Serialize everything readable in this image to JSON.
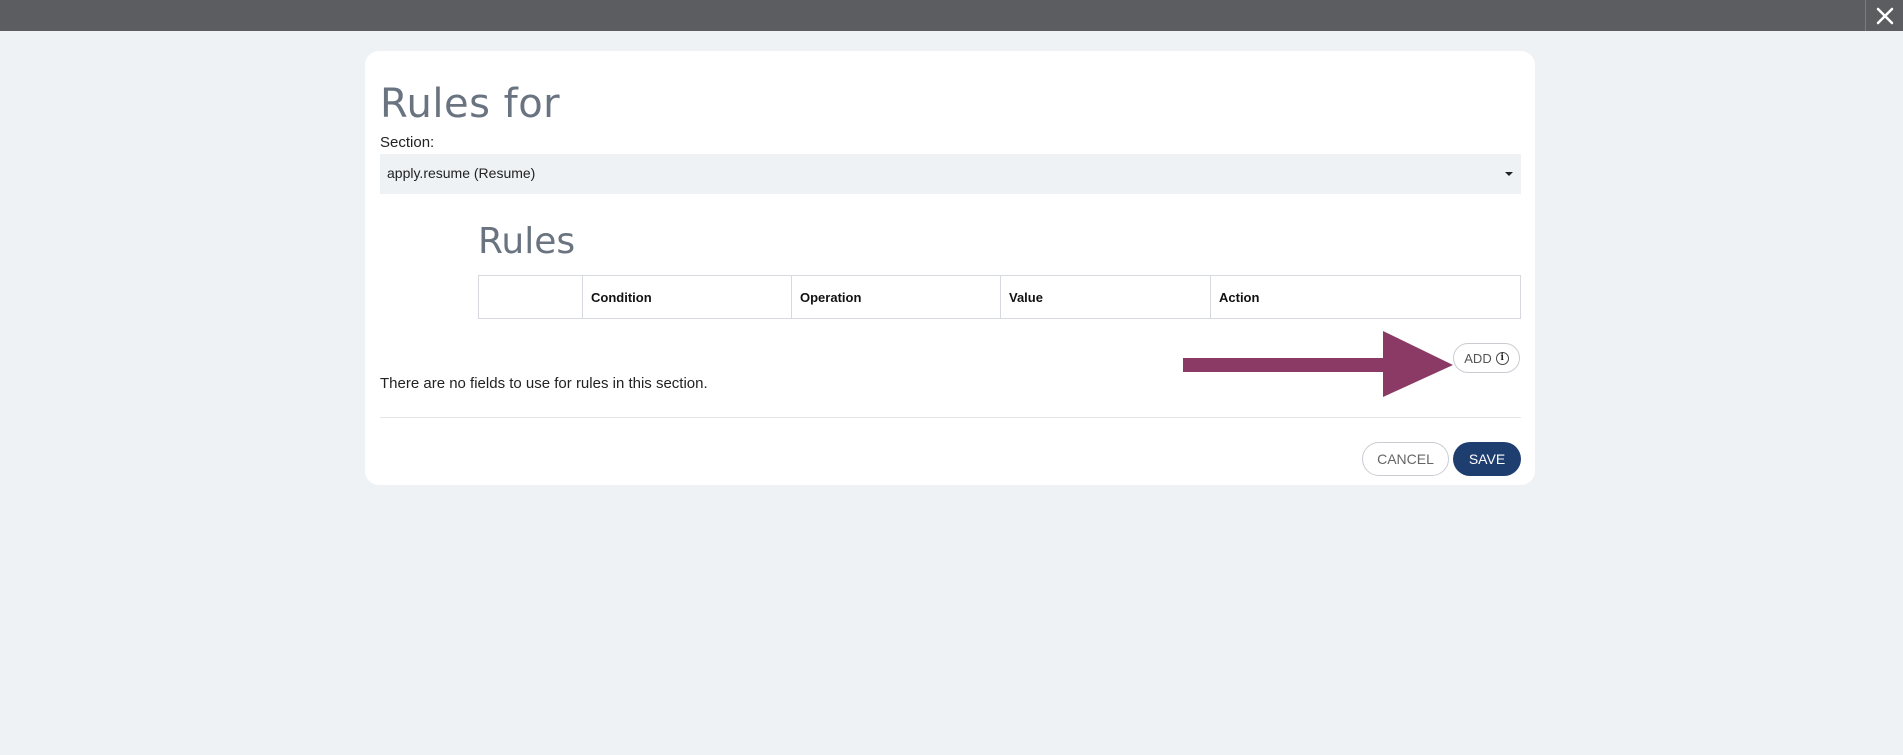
{
  "header": {
    "close_icon": "close-icon"
  },
  "modal": {
    "title": "Rules for",
    "section_label": "Section:",
    "section_value": "apply.resume (Resume)",
    "rules_heading": "Rules",
    "columns": [
      "",
      "Condition",
      "Operation",
      "Value",
      "Action"
    ],
    "add_label": "ADD",
    "add_icon": "info-icon",
    "empty_message": "There are no fields to use for rules in this section.",
    "cancel_label": "CANCEL",
    "save_label": "SAVE"
  },
  "colors": {
    "topbar": "#5b5d60",
    "background": "#eef2f5",
    "annotation_arrow": "#8b3a66",
    "save_button": "#1f3e70"
  }
}
